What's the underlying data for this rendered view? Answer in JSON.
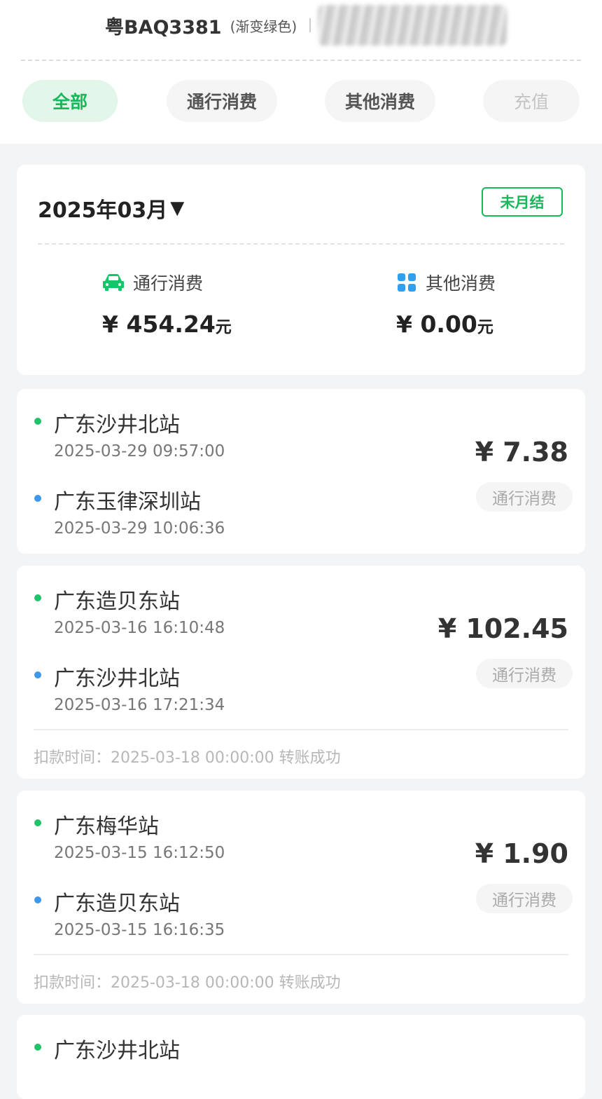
{
  "vehicle": {
    "plate": "粤BAQ3381",
    "plate_color": "(渐变绿色)"
  },
  "tabs": [
    {
      "label": "全部",
      "active": true
    },
    {
      "label": "通行消费",
      "active": false
    },
    {
      "label": "其他消费",
      "active": false
    },
    {
      "label": "充值",
      "active": false,
      "disabled": true
    }
  ],
  "summary": {
    "month": "2025年03月",
    "caret": "▼",
    "status_badge": "未月结",
    "toll": {
      "icon": "car-icon",
      "label": "通行消费",
      "amount": "¥ 454.24",
      "unit": "元"
    },
    "other": {
      "icon": "grid-icon",
      "label": "其他消费",
      "amount": "¥ 0.00",
      "unit": "元"
    }
  },
  "records": [
    {
      "entry_station": "广东沙井北站",
      "entry_time": "2025-03-29 09:57:00",
      "exit_station": "广东玉律深圳站",
      "exit_time": "2025-03-29 10:06:36",
      "amount": "¥ 7.38",
      "type": "通行消费"
    },
    {
      "entry_station": "广东造贝东站",
      "entry_time": "2025-03-16 16:10:48",
      "exit_station": "广东沙井北站",
      "exit_time": "2025-03-16 17:21:34",
      "amount": "¥ 102.45",
      "type": "通行消费",
      "deduct": "扣款时间：2025-03-18 00:00:00 转账成功"
    },
    {
      "entry_station": "广东梅华站",
      "entry_time": "2025-03-15 16:12:50",
      "exit_station": "广东造贝东站",
      "exit_time": "2025-03-15 16:16:35",
      "amount": "¥ 1.90",
      "type": "通行消费",
      "deduct": "扣款时间：2025-03-18 00:00:00 转账成功"
    },
    {
      "entry_station": "广东沙井北站"
    }
  ],
  "colors": {
    "accent": "#16b85a",
    "entry_dot": "#20c36a",
    "exit_dot": "#3d97ea",
    "toll_icon": "#16c46a",
    "other_icon": "#2fa0ee"
  }
}
